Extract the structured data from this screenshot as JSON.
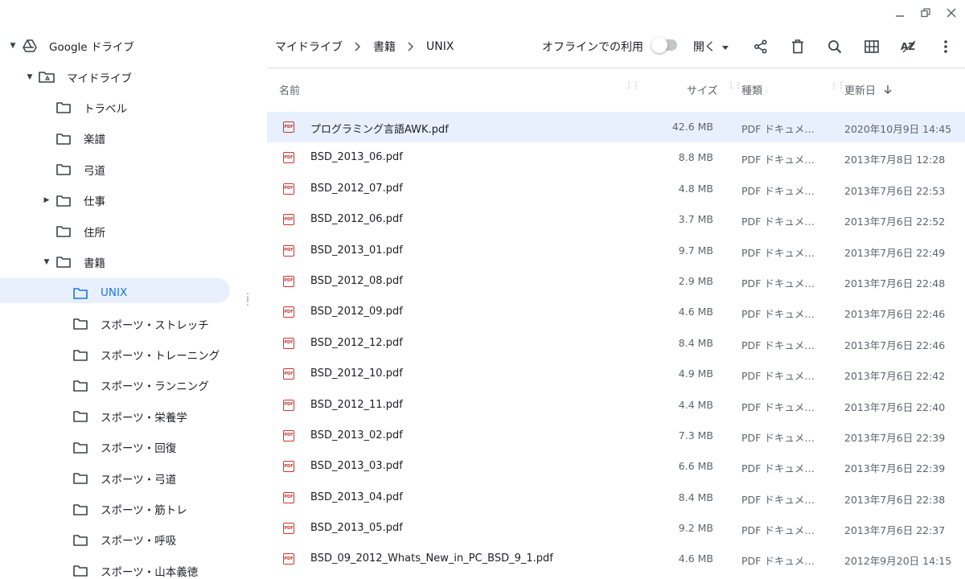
{
  "window": {
    "minimize_icon": "minimize-icon",
    "restore_icon": "restore-icon",
    "close_icon": "close-icon"
  },
  "sidebar": {
    "root": {
      "label": "Google ドライブ",
      "icon": "google-drive-icon"
    },
    "items": [
      {
        "label": "マイドライブ",
        "level": 1,
        "expanded": true,
        "icon": "my-drive-icon"
      },
      {
        "label": "トラベル",
        "level": 2,
        "icon": "folder-icon"
      },
      {
        "label": "楽譜",
        "level": 2,
        "icon": "folder-icon"
      },
      {
        "label": "弓道",
        "level": 2,
        "icon": "folder-icon"
      },
      {
        "label": "仕事",
        "level": 2,
        "collapsed": true,
        "icon": "folder-icon"
      },
      {
        "label": "住所",
        "level": 2,
        "icon": "folder-icon"
      },
      {
        "label": "書籍",
        "level": 2,
        "expanded": true,
        "icon": "folder-icon"
      },
      {
        "label": "UNIX",
        "level": 3,
        "selected": true,
        "icon": "folder-icon"
      },
      {
        "label": "スポーツ・ストレッチ",
        "level": 3,
        "icon": "folder-icon"
      },
      {
        "label": "スポーツ・トレーニング",
        "level": 3,
        "icon": "folder-icon"
      },
      {
        "label": "スポーツ・ランニング",
        "level": 3,
        "icon": "folder-icon"
      },
      {
        "label": "スポーツ・栄養学",
        "level": 3,
        "icon": "folder-icon"
      },
      {
        "label": "スポーツ・回復",
        "level": 3,
        "icon": "folder-icon"
      },
      {
        "label": "スポーツ・弓道",
        "level": 3,
        "icon": "folder-icon"
      },
      {
        "label": "スポーツ・筋トレ",
        "level": 3,
        "icon": "folder-icon"
      },
      {
        "label": "スポーツ・呼吸",
        "level": 3,
        "icon": "folder-icon"
      },
      {
        "label": "スポーツ・山本義徳",
        "level": 3,
        "icon": "folder-icon"
      }
    ]
  },
  "header": {
    "breadcrumb": [
      "マイドライブ",
      "書籍",
      "UNIX"
    ],
    "offline_label": "オフラインでの利用",
    "offline_enabled": false,
    "open_label": "開く",
    "tools": [
      "share-icon",
      "delete-icon",
      "search-icon",
      "grid-view-icon",
      "sort-az-icon",
      "more-vert-icon"
    ]
  },
  "columns": {
    "name": "名前",
    "size": "サイズ",
    "type": "種類",
    "modified": "更新日",
    "sort_icon": "arrow-down-icon"
  },
  "files": [
    {
      "name": "プログラミング言語AWK.pdf",
      "size": "42.6 MB",
      "type": "PDF ドキュメント",
      "modified": "2020年10月9日 14:45",
      "selected": true
    },
    {
      "name": "BSD_2013_06.pdf",
      "size": "8.8 MB",
      "type": "PDF ドキュメント",
      "modified": "2013年7月8日 12:28"
    },
    {
      "name": "BSD_2012_07.pdf",
      "size": "4.8 MB",
      "type": "PDF ドキュメント",
      "modified": "2013年7月6日 22:53"
    },
    {
      "name": "BSD_2012_06.pdf",
      "size": "3.7 MB",
      "type": "PDF ドキュメント",
      "modified": "2013年7月6日 22:52"
    },
    {
      "name": "BSD_2013_01.pdf",
      "size": "9.7 MB",
      "type": "PDF ドキュメント",
      "modified": "2013年7月6日 22:49"
    },
    {
      "name": "BSD_2012_08.pdf",
      "size": "2.9 MB",
      "type": "PDF ドキュメント",
      "modified": "2013年7月6日 22:48"
    },
    {
      "name": "BSD_2012_09.pdf",
      "size": "4.6 MB",
      "type": "PDF ドキュメント",
      "modified": "2013年7月6日 22:46"
    },
    {
      "name": "BSD_2012_12.pdf",
      "size": "8.4 MB",
      "type": "PDF ドキュメント",
      "modified": "2013年7月6日 22:46"
    },
    {
      "name": "BSD_2012_10.pdf",
      "size": "4.9 MB",
      "type": "PDF ドキュメント",
      "modified": "2013年7月6日 22:42"
    },
    {
      "name": "BSD_2012_11.pdf",
      "size": "4.4 MB",
      "type": "PDF ドキュメント",
      "modified": "2013年7月6日 22:40"
    },
    {
      "name": "BSD_2013_02.pdf",
      "size": "7.3 MB",
      "type": "PDF ドキュメント",
      "modified": "2013年7月6日 22:39"
    },
    {
      "name": "BSD_2013_03.pdf",
      "size": "6.6 MB",
      "type": "PDF ドキュメント",
      "modified": "2013年7月6日 22:39"
    },
    {
      "name": "BSD_2013_04.pdf",
      "size": "8.4 MB",
      "type": "PDF ドキュメント",
      "modified": "2013年7月6日 22:38"
    },
    {
      "name": "BSD_2013_05.pdf",
      "size": "9.2 MB",
      "type": "PDF ドキュメント",
      "modified": "2013年7月6日 22:37"
    },
    {
      "name": "BSD_09_2012_Whats_New_in_PC_BSD_9_1.pdf",
      "size": "4.6 MB",
      "type": "PDF ドキュメント",
      "modified": "2012年9月20日 14:15"
    }
  ],
  "colors": {
    "accent": "#1a73e8",
    "selection": "#e8f0fe",
    "pdf_red": "#d93025"
  }
}
